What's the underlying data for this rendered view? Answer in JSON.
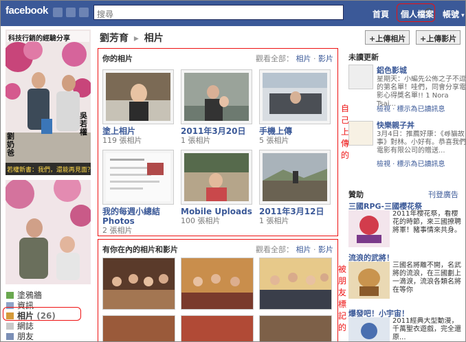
{
  "topbar": {
    "logo": "facebook",
    "search_placeholder": "搜尋",
    "nav_home": "首頁",
    "nav_profile": "個人檔案",
    "nav_account": "帳號",
    "colors": {
      "bar": "#3b5998",
      "annotation": "#ee1111"
    }
  },
  "left": {
    "profile_caption_top": "科技行銷的經驗分享",
    "profile_name_left": "劉奶爸",
    "profile_name_right": "吳若權",
    "profile_caption_bottom": "若權新書：我們，還能再見面？",
    "nav": [
      {
        "label": "塗鴉牆",
        "icon": "wall-icon"
      },
      {
        "label": "資訊",
        "icon": "info-icon"
      },
      {
        "label": "相片",
        "count": "(26)",
        "icon": "photos-icon"
      },
      {
        "label": "網誌",
        "icon": "notes-icon"
      },
      {
        "label": "朋友",
        "icon": "friends-icon"
      }
    ]
  },
  "main": {
    "breadcrumb_name": "劉芳育",
    "breadcrumb_sep": "▸",
    "breadcrumb_page": "相片",
    "your_photos": {
      "title": "你的相片",
      "view_all": "觀看全部：",
      "link_photos": "相片",
      "link_dot": "·",
      "link_videos": "影片",
      "albums": [
        {
          "title": "塗上相片",
          "count": "119 張相片"
        },
        {
          "title": "2011年3月20日",
          "count": "1 張相片"
        },
        {
          "title": "手機上傳",
          "count": "5 張相片"
        },
        {
          "title": "我的每週小總結 Photos",
          "count": "2 張相片"
        },
        {
          "title": "Mobile Uploads",
          "count": "100 張相片"
        },
        {
          "title": "2011年3月12日",
          "count": "1 張相片"
        }
      ]
    },
    "tagged": {
      "title": "有你在內的相片和影片",
      "view_all": "觀看全部：",
      "link_photos": "相片",
      "link_dot": "·",
      "link_videos": "影片"
    },
    "annotation_self": "自己上傳的",
    "annotation_tagged": "被朋友標記的"
  },
  "right": {
    "upload_photos": "上傳相片",
    "upload_videos": "上傳影片",
    "updates_title": "未讀更新",
    "update1_title": "鋁色影城",
    "update1_text": "星期天：小編先公佈之子不逗的第名單！哇們，同會分享電影心得獎名單!! 1 Nora Tsai...",
    "update1_actions": "檢視 · 標示為已讀訊息",
    "update2_title": "快樂親子丼",
    "update2_text": "3月4日：推薦好康：《尋貓故事》對林。小好有。恭喜我們電影有限公司的贈送...",
    "update2_actions": "檢視 · 標示為已讀訊息",
    "sponsor_title": "贊助",
    "sponsor_link": "刊登廣告",
    "ads": [
      {
        "title": "三國RPG-三國櫻花祭",
        "text": "2011年櫻花祭，看櫻花的時節，來三國撩聘將軍！豬事情來共身。"
      },
      {
        "title": "流浪的武將！",
        "text": "三國名將離不開，名武將的流浪，在三國劃上一滴淚，流浪各類名將在等你"
      },
      {
        "title": "爆發吧！小宇宙！",
        "text": "2011經典大型動漫，千萬聖衣遊戲，完全還原..."
      }
    ]
  }
}
